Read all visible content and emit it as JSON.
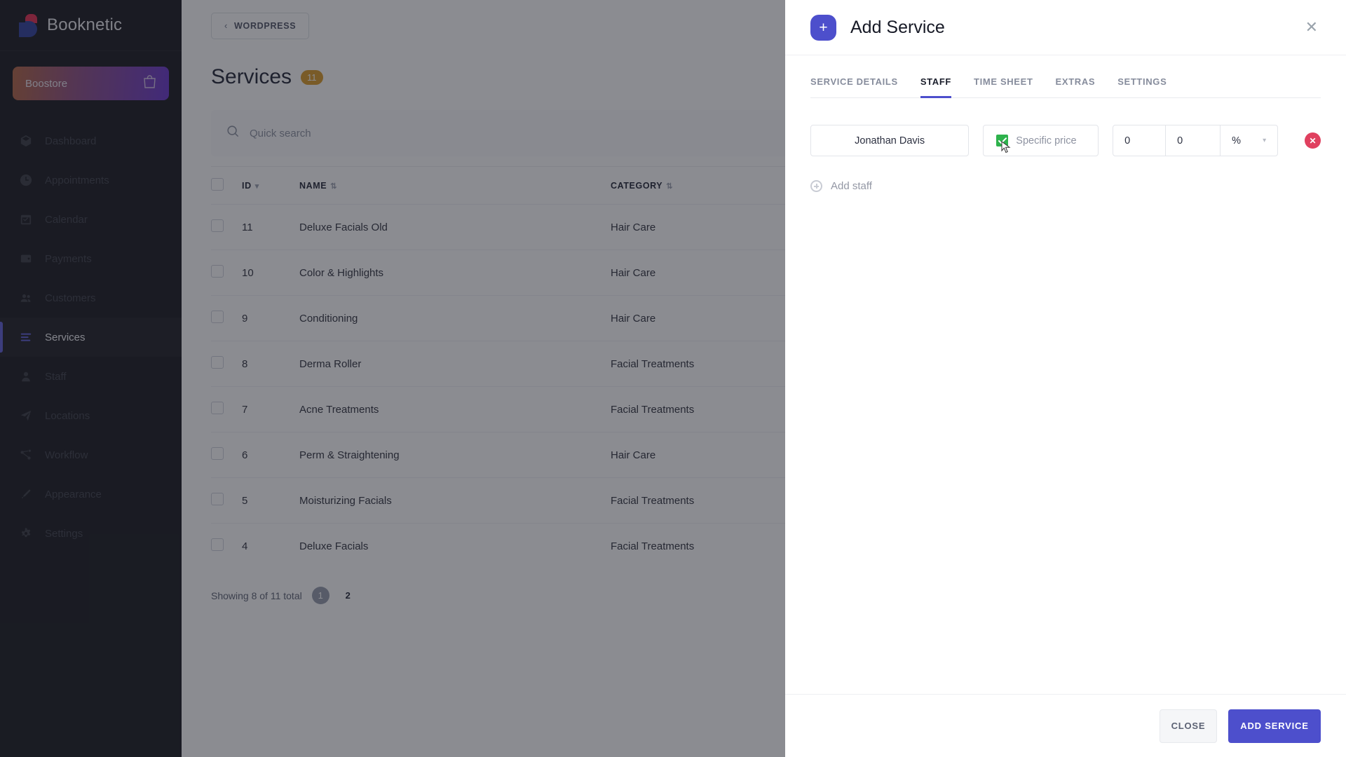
{
  "brand": {
    "name": "Booknetic",
    "logo_icon": "booknetic-logo-icon"
  },
  "store": {
    "label": "Boostore",
    "icon": "shopping-bag-icon"
  },
  "sidebar": {
    "items": [
      {
        "label": "Dashboard",
        "icon": "box-icon",
        "active": false
      },
      {
        "label": "Appointments",
        "icon": "clock-icon",
        "active": false
      },
      {
        "label": "Calendar",
        "icon": "calendar-icon",
        "active": false
      },
      {
        "label": "Payments",
        "icon": "wallet-icon",
        "active": false
      },
      {
        "label": "Customers",
        "icon": "users-icon",
        "active": false
      },
      {
        "label": "Services",
        "icon": "list-icon",
        "active": true
      },
      {
        "label": "Staff",
        "icon": "person-icon",
        "active": false
      },
      {
        "label": "Locations",
        "icon": "send-icon",
        "active": false
      },
      {
        "label": "Workflow",
        "icon": "workflow-icon",
        "active": false
      },
      {
        "label": "Appearance",
        "icon": "brush-icon",
        "active": false
      },
      {
        "label": "Settings",
        "icon": "gear-icon",
        "active": false
      }
    ]
  },
  "topbar": {
    "wordpress_label": "WORDPRESS",
    "back_chevron": "‹"
  },
  "page": {
    "title": "Services",
    "count": "11"
  },
  "search": {
    "placeholder": "Quick search",
    "value": "",
    "icon": "search-icon"
  },
  "table": {
    "columns": [
      "ID",
      "NAME",
      "CATEGORY"
    ],
    "rows": [
      {
        "id": "11",
        "name": "Deluxe Facials Old",
        "category": "Hair Care"
      },
      {
        "id": "10",
        "name": "Color & Highlights",
        "category": "Hair Care"
      },
      {
        "id": "9",
        "name": "Conditioning",
        "category": "Hair Care"
      },
      {
        "id": "8",
        "name": "Derma Roller",
        "category": "Facial Treatments"
      },
      {
        "id": "7",
        "name": "Acne Treatments",
        "category": "Facial Treatments"
      },
      {
        "id": "6",
        "name": "Perm & Straightening",
        "category": "Hair Care"
      },
      {
        "id": "5",
        "name": "Moisturizing Facials",
        "category": "Facial Treatments"
      },
      {
        "id": "4",
        "name": "Deluxe Facials",
        "category": "Facial Treatments"
      }
    ]
  },
  "pagination": {
    "summary": "Showing 8 of 11 total",
    "current_page": "1",
    "next_page": "2"
  },
  "modal": {
    "title": "Add Service",
    "plus_icon": "plus-icon",
    "close_icon": "close-icon",
    "tabs": [
      {
        "label": "SERVICE DETAILS",
        "active": false
      },
      {
        "label": "STAFF",
        "active": true
      },
      {
        "label": "TIME SHEET",
        "active": false
      },
      {
        "label": "EXTRAS",
        "active": false
      },
      {
        "label": "SETTINGS",
        "active": false
      }
    ],
    "staff_rows": [
      {
        "staff_name": "Jonathan Davis",
        "specific_price_label": "Specific price",
        "specific_price_checked": true,
        "price": "0",
        "deposit": "0",
        "unit": "%",
        "delete_icon": "delete-circle-icon"
      }
    ],
    "add_staff_label": "Add staff",
    "footer": {
      "close_label": "CLOSE",
      "submit_label": "ADD SERVICE"
    }
  },
  "colors": {
    "accent": "#4d4fcc",
    "sidebar_bg": "#131419",
    "badge": "#d99a24",
    "checkbox_green": "#2eb24c",
    "delete_red": "#e0405f"
  }
}
